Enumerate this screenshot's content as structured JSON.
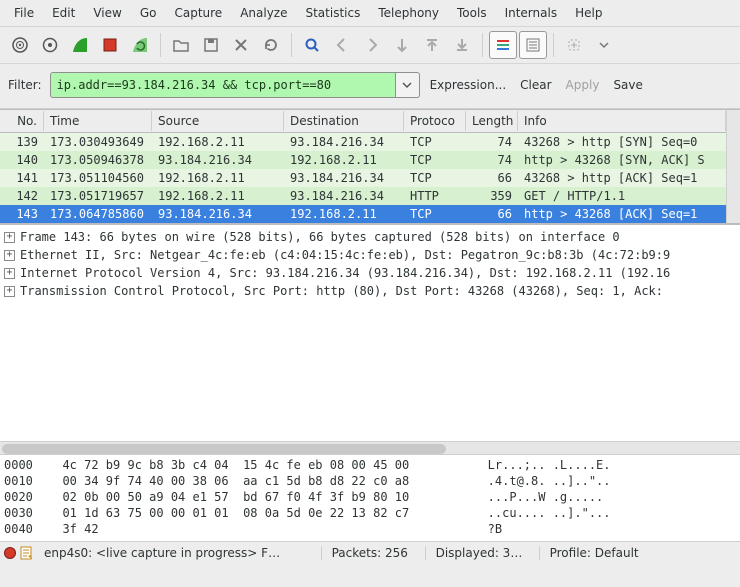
{
  "menu": {
    "items": [
      "File",
      "Edit",
      "View",
      "Go",
      "Capture",
      "Analyze",
      "Statistics",
      "Telephony",
      "Tools",
      "Internals",
      "Help"
    ]
  },
  "toolbar": {
    "icons": [
      "interfaces-icon",
      "options-icon",
      "start-capture-icon",
      "stop-capture-icon",
      "restart-capture-icon",
      "open-file-icon",
      "save-file-icon",
      "close-file-icon",
      "reload-icon",
      "find-icon",
      "go-back-icon",
      "go-forward-icon",
      "jump-to-icon",
      "first-packet-icon",
      "last-packet-icon",
      "colorize-icon",
      "auto-scroll-icon",
      "zoom-icon",
      "zoom-dropdown-icon"
    ]
  },
  "filter": {
    "label": "Filter:",
    "value": "ip.addr==93.184.216.34 && tcp.port==80",
    "expression": "Expression...",
    "clear": "Clear",
    "apply": "Apply",
    "save": "Save"
  },
  "columns": {
    "no": "No.",
    "time": "Time",
    "src": "Source",
    "dst": "Destination",
    "proto": "Protoco",
    "len": "Length",
    "info": "Info"
  },
  "packets": [
    {
      "no": "139",
      "time": "173.030493649",
      "src": "192.168.2.11",
      "dst": "93.184.216.34",
      "proto": "TCP",
      "len": "74",
      "info": "43268 > http [SYN] Seq=0",
      "cls": "row-green-lt"
    },
    {
      "no": "140",
      "time": "173.050946378",
      "src": "93.184.216.34",
      "dst": "192.168.2.11",
      "proto": "TCP",
      "len": "74",
      "info": "http > 43268 [SYN, ACK] S",
      "cls": "row-green-md"
    },
    {
      "no": "141",
      "time": "173.051104560",
      "src": "192.168.2.11",
      "dst": "93.184.216.34",
      "proto": "TCP",
      "len": "66",
      "info": "43268 > http [ACK] Seq=1",
      "cls": "row-green-lt"
    },
    {
      "no": "142",
      "time": "173.051719657",
      "src": "192.168.2.11",
      "dst": "93.184.216.34",
      "proto": "HTTP",
      "len": "359",
      "info": "GET / HTTP/1.1",
      "cls": "row-green-md"
    },
    {
      "no": "143",
      "time": "173.064785860",
      "src": "93.184.216.34",
      "dst": "192.168.2.11",
      "proto": "TCP",
      "len": "66",
      "info": "http > 43268 [ACK] Seq=1",
      "cls": "row-selected"
    }
  ],
  "tree": {
    "n0": "Frame 143: 66 bytes on wire (528 bits), 66 bytes captured (528 bits) on interface 0",
    "n1": "Ethernet II, Src: Netgear_4c:fe:eb (c4:04:15:4c:fe:eb), Dst: Pegatron_9c:b8:3b (4c:72:b9:9",
    "n2": "Internet Protocol Version 4, Src: 93.184.216.34 (93.184.216.34), Dst: 192.168.2.11 (192.16",
    "n3": "Transmission Control Protocol, Src Port: http (80), Dst Port: 43268 (43268), Seq: 1, Ack:"
  },
  "hex": [
    {
      "off": "0000",
      "bytes": "4c 72 b9 9c b8 3b c4 04  15 4c fe eb 08 00 45 00",
      "ascii": "Lr...;.. .L....E."
    },
    {
      "off": "0010",
      "bytes": "00 34 9f 74 40 00 38 06  aa c1 5d b8 d8 22 c0 a8",
      "ascii": ".4.t@.8. ..]..\".."
    },
    {
      "off": "0020",
      "bytes": "02 0b 00 50 a9 04 e1 57  bd 67 f0 4f 3f b9 80 10",
      "ascii": "...P...W .g.....  "
    },
    {
      "off": "0030",
      "bytes": "01 1d 63 75 00 00 01 01  08 0a 5d 0e 22 13 82 c7",
      "ascii": "..cu.... ..].\"..."
    },
    {
      "off": "0040",
      "bytes": "3f 42                                          ",
      "ascii": "?B"
    }
  ],
  "status": {
    "iface": "enp4s0: <live capture in progress> F…",
    "packets": "Packets: 256",
    "displayed": "Displayed: 3…",
    "profile": "Profile: Default"
  }
}
